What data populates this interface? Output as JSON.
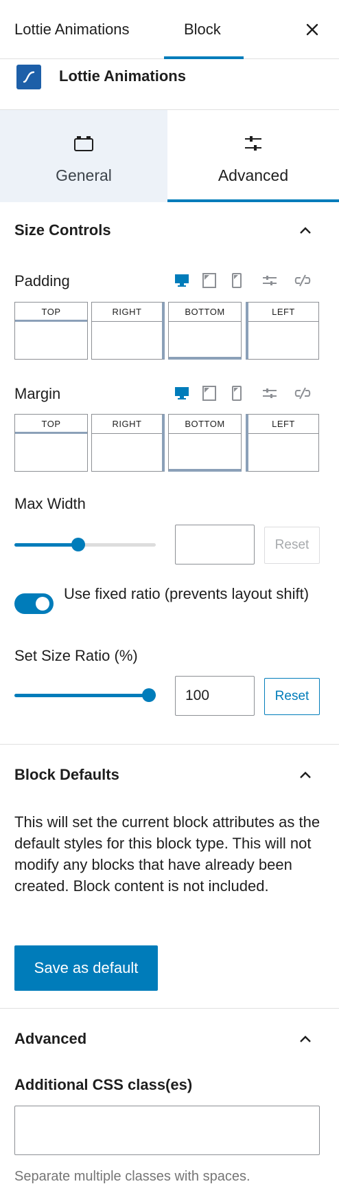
{
  "header": {
    "tabs": [
      {
        "label": "Lottie Animations"
      },
      {
        "label": "Block"
      }
    ],
    "close_icon": "close-icon"
  },
  "block": {
    "name": "Lottie Animations",
    "icon": "lottie-icon",
    "icon_color": "#1d5fa8"
  },
  "panel_tabs": [
    {
      "label": "General",
      "icon": "general-icon"
    },
    {
      "label": "Advanced",
      "icon": "sliders-icon"
    }
  ],
  "size_controls": {
    "title": "Size Controls",
    "padding": {
      "label": "Padding",
      "sides": [
        "TOP",
        "RIGHT",
        "BOTTOM",
        "LEFT"
      ],
      "values": [
        "",
        "",
        "",
        ""
      ]
    },
    "margin": {
      "label": "Margin",
      "sides": [
        "TOP",
        "RIGHT",
        "BOTTOM",
        "LEFT"
      ],
      "values": [
        "",
        "",
        "",
        ""
      ]
    },
    "device_icons": [
      "desktop-icon",
      "tablet-icon",
      "mobile-icon",
      "sliders-icon",
      "unlink-icon"
    ],
    "max_width": {
      "label": "Max Width",
      "value": "",
      "slider_fraction": 0.45,
      "reset_label": "Reset"
    },
    "fixed_ratio": {
      "label": "Use fixed ratio (prevents layout shift)",
      "enabled": true
    },
    "size_ratio": {
      "label": "Set Size Ratio (%)",
      "value": "100",
      "slider_fraction": 1.0,
      "reset_label": "Reset"
    }
  },
  "block_defaults": {
    "title": "Block Defaults",
    "description": "This will set the current block attributes as the default styles for this block type. This will not modify any blocks that have already been created. Block content is not included.",
    "button_label": "Save as default"
  },
  "advanced": {
    "title": "Advanced",
    "css_label": "Additional CSS class(es)",
    "css_value": "",
    "help": "Separate multiple classes with spaces."
  },
  "colors": {
    "accent": "#007cba",
    "tab_bg": "#edf2f8",
    "border": "#8c8f94"
  }
}
